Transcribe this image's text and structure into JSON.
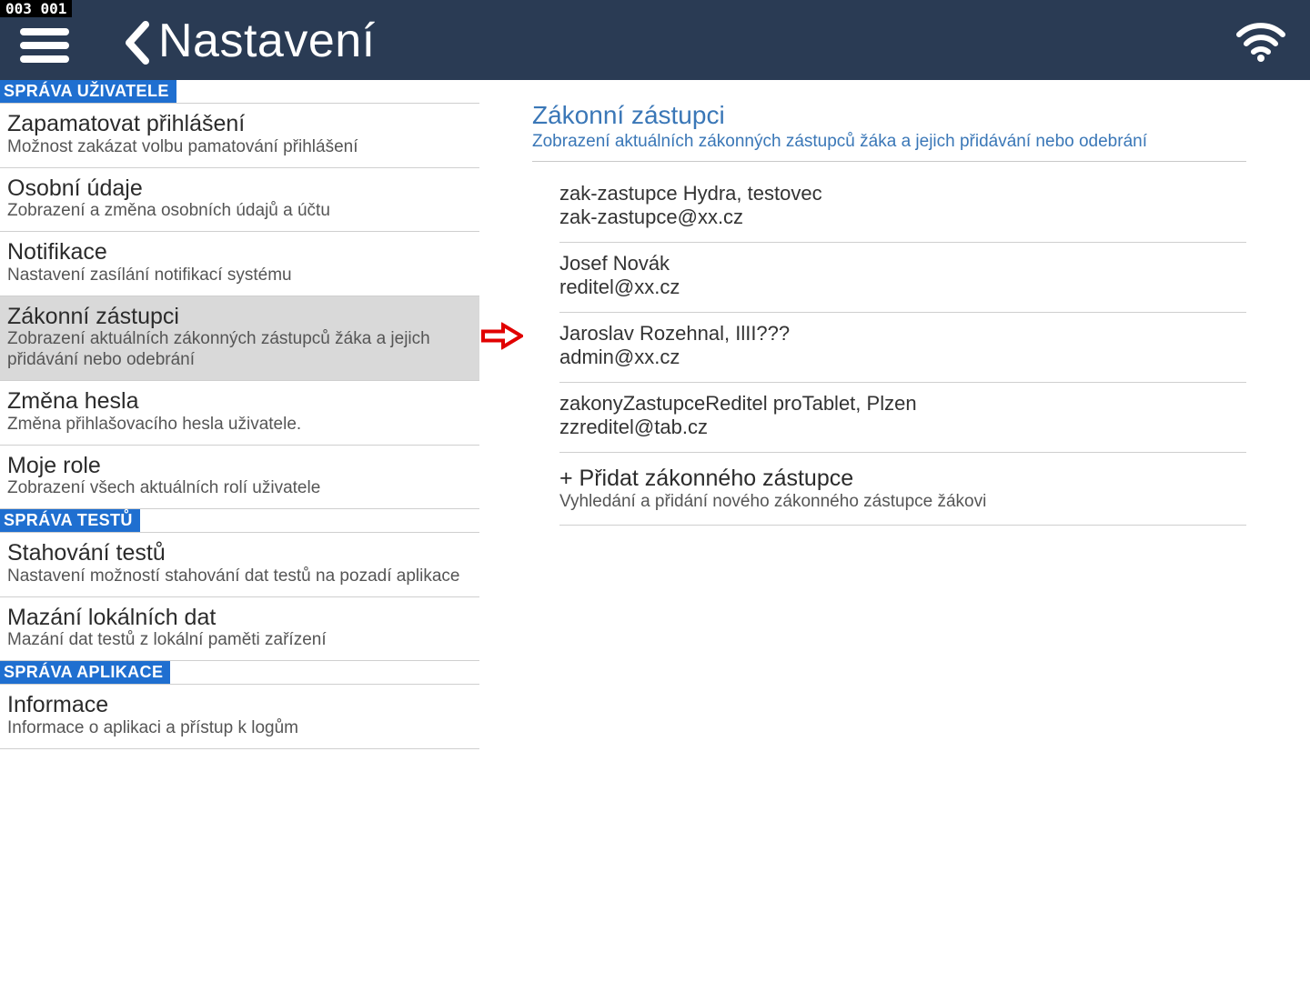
{
  "status_bar": "003  001",
  "header": {
    "title": "Nastavení"
  },
  "sections": [
    {
      "id": "user",
      "label": "SPRÁVA UŽIVATELE",
      "items": [
        {
          "id": "remember-login",
          "title": "Zapamatovat přihlášení",
          "sub": "Možnost zakázat volbu pamatování přihlášení"
        },
        {
          "id": "personal-data",
          "title": "Osobní údaje",
          "sub": "Zobrazení a změna osobních údajů a účtu"
        },
        {
          "id": "notifications",
          "title": "Notifikace",
          "sub": "Nastavení zasílání notifikací systému"
        },
        {
          "id": "guardians",
          "title": "Zákonní zástupci",
          "sub": "Zobrazení aktuálních zákonných zástupců žáka a jejich přidávání nebo odebrání",
          "selected": true
        },
        {
          "id": "change-password",
          "title": "Změna hesla",
          "sub": "Změna přihlašovacího hesla uživatele."
        },
        {
          "id": "my-roles",
          "title": "Moje role",
          "sub": "Zobrazení všech aktuálních rolí uživatele"
        }
      ]
    },
    {
      "id": "tests",
      "label": "SPRÁVA TESTŮ",
      "items": [
        {
          "id": "download-tests",
          "title": "Stahování testů",
          "sub": "Nastavení možností stahování dat testů na pozadí aplikace"
        },
        {
          "id": "delete-local",
          "title": "Mazání lokálních dat",
          "sub": "Mazání dat testů z lokální paměti zařízení"
        }
      ]
    },
    {
      "id": "app",
      "label": "SPRÁVA APLIKACE",
      "items": [
        {
          "id": "information",
          "title": "Informace",
          "sub": "Informace o aplikaci a přístup k logům"
        }
      ]
    }
  ],
  "panel": {
    "title": "Zákonní zástupci",
    "sub": "Zobrazení aktuálních zákonných zástupců žáka a jejich přidávání nebo odebrání",
    "guardians": [
      {
        "name": "zak-zastupce Hydra, testovec",
        "email": "zak-zastupce@xx.cz"
      },
      {
        "name": "Josef Novák",
        "email": "reditel@xx.cz"
      },
      {
        "name": "Jaroslav Rozehnal, IlII???",
        "email": "admin@xx.cz"
      },
      {
        "name": "zakonyZastupceReditel proTablet, Plzen",
        "email": "zzreditel@tab.cz"
      }
    ],
    "add": {
      "title": "+ Přidat zákonného zástupce",
      "sub": "Vyhledání a přidání nového zákonného zástupce žákovi"
    }
  }
}
